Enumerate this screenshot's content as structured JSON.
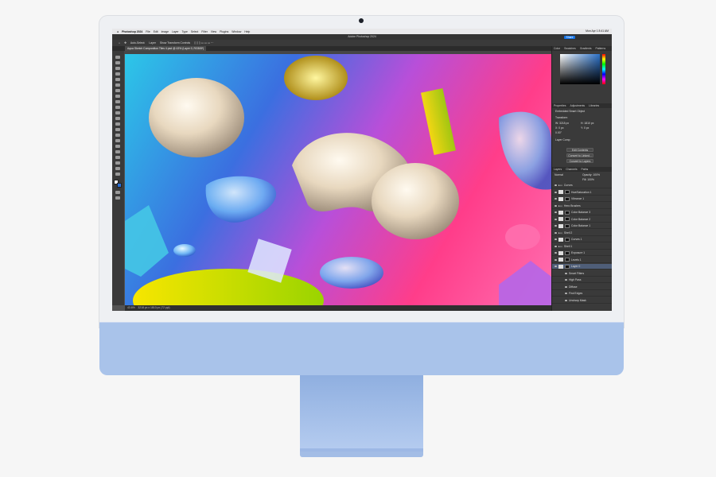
{
  "menubar": {
    "apple": "",
    "app_name": "Photoshop 2024",
    "items": [
      "File",
      "Edit",
      "Image",
      "Layer",
      "Type",
      "Select",
      "Filter",
      "View",
      "Plugins",
      "Window",
      "Help"
    ],
    "clock": "Mon Apr 1 8:41 AM"
  },
  "window_title": "Adobe Photoshop 2024",
  "share_label": "Share",
  "options": {
    "auto_select": "Auto-Select:",
    "target": "Layer",
    "transform": "Show Transform Controls"
  },
  "document_tab": "Aqua Sketch Composition Tiles 4.psd @ 43% (Layer 0, RGB/8*)",
  "status": {
    "zoom": "43.6%",
    "dimensions": "3218 px x 1810 px (72 ppi)"
  },
  "panels": {
    "color_tabs": [
      "Color",
      "Swatches",
      "Gradients",
      "Patterns"
    ],
    "properties_tabs": [
      "Properties",
      "Adjustments",
      "Libraries"
    ],
    "properties_title": "Embedded Smart Object",
    "transform_label": "Transform",
    "w": "W: 3218 px",
    "h": "H: 1810 px",
    "x": "X: 0 px",
    "y": "Y: 0 px",
    "angle": "0.00°",
    "layer_comp": "Layer Comp",
    "buttons": [
      "Edit Contents",
      "Convert to Linked...",
      "Convert to Layers"
    ],
    "layers_tabs": [
      "Layers",
      "Channels",
      "Paths"
    ],
    "blend_mode": "Normal",
    "opacity": "Opacity: 100%",
    "fill": "Fill: 100%",
    "layers": [
      {
        "name": "Curves",
        "kind": "group"
      },
      {
        "name": "Hue/Saturation 1",
        "kind": "adj"
      },
      {
        "name": "Vibrance 1",
        "kind": "adj"
      },
      {
        "name": "Hero Brushes",
        "kind": "group"
      },
      {
        "name": "Color Balance 3",
        "kind": "adj"
      },
      {
        "name": "Color Balance 2",
        "kind": "adj"
      },
      {
        "name": "Color Balance 1",
        "kind": "adj"
      },
      {
        "name": "Shell 2",
        "kind": "group"
      },
      {
        "name": "Curves 1",
        "kind": "adj"
      },
      {
        "name": "Shell 1",
        "kind": "group"
      },
      {
        "name": "Exposure 1",
        "kind": "adj"
      },
      {
        "name": "Levels 1",
        "kind": "adj"
      },
      {
        "name": "Layer 0",
        "kind": "layer",
        "selected": true
      },
      {
        "name": "Smart Filters",
        "kind": "sub"
      },
      {
        "name": "High Pass",
        "kind": "sub"
      },
      {
        "name": "Diffuse",
        "kind": "sub"
      },
      {
        "name": "Find Edges",
        "kind": "sub"
      },
      {
        "name": "Unsharp Mask",
        "kind": "sub"
      }
    ]
  },
  "colors": {
    "accent": "#1473e6",
    "chin": "#a9c3ea",
    "panel_bg": "#3a3a3a"
  }
}
